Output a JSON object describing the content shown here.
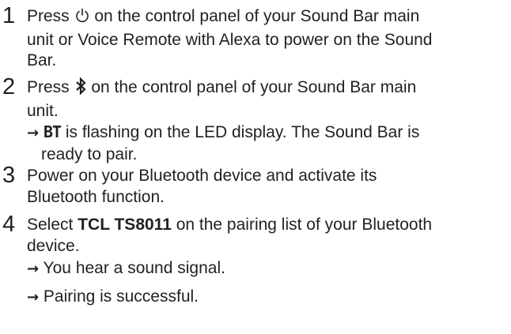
{
  "steps": [
    {
      "number": "1",
      "lines": [
        {
          "before": "Press ",
          "icon": "power-icon",
          "after": " on the control panel of your Sound Bar main"
        },
        {
          "text": "unit or Voice Remote with Alexa to power on the Sound"
        },
        {
          "text": "Bar."
        }
      ]
    },
    {
      "number": "2",
      "lines": [
        {
          "before": "Press ",
          "icon": "bluetooth-icon",
          "after": " on the control panel of your Sound Bar main"
        },
        {
          "text": "unit."
        }
      ],
      "subs": [
        {
          "arrow": "→",
          "badge": "BT",
          "text1": " is flashing on the LED display. The Sound Bar is",
          "text2": "ready to pair."
        }
      ]
    },
    {
      "number": "3",
      "lines": [
        {
          "text": "Power on your Bluetooth device and activate its"
        },
        {
          "text": "Bluetooth function."
        }
      ]
    },
    {
      "number": "4",
      "lines": [
        {
          "before": "Select ",
          "bold": "TCL TS8011",
          "after": " on the pairing list of your Bluetooth"
        },
        {
          "text": "device."
        }
      ],
      "subs": [
        {
          "arrow": "→",
          "text1": " You hear a sound signal."
        },
        {
          "arrow": "→",
          "text1": " Pairing is successful."
        }
      ]
    }
  ]
}
